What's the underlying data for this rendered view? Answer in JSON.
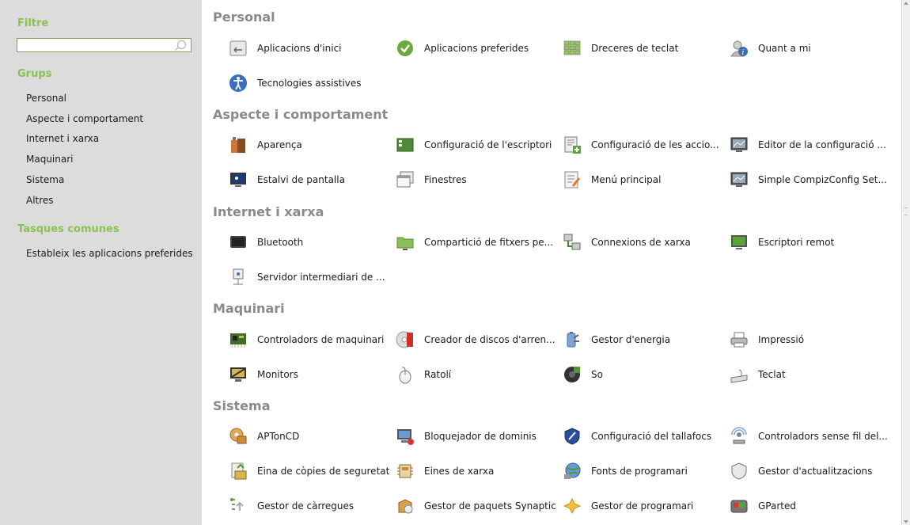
{
  "sidebar": {
    "filter_heading": "Filtre",
    "search_placeholder": "",
    "groups_heading": "Grups",
    "groups": [
      "Personal",
      "Aspecte i comportament",
      "Internet i xarxa",
      "Maquinari",
      "Sistema",
      "Altres"
    ],
    "tasks_heading": "Tasques comunes",
    "tasks": [
      "Estableix les aplicacions preferides"
    ]
  },
  "sections": [
    {
      "title": "Personal",
      "items": [
        {
          "label": "Aplicacions d'inici",
          "icon": "startup-apps-icon"
        },
        {
          "label": "Aplicacions preferides",
          "icon": "preferred-apps-icon"
        },
        {
          "label": "Dreceres de teclat",
          "icon": "keyboard-shortcuts-icon"
        },
        {
          "label": "Quant a mi",
          "icon": "about-me-icon"
        },
        {
          "label": "Tecnologies assistives",
          "icon": "accessibility-icon"
        }
      ]
    },
    {
      "title": "Aspecte i comportament",
      "items": [
        {
          "label": "Aparença",
          "icon": "appearance-icon"
        },
        {
          "label": "Configuració de l'escriptori",
          "icon": "desktop-settings-icon"
        },
        {
          "label": "Configuració de les accio...",
          "icon": "actions-settings-icon"
        },
        {
          "label": "Editor de la configuració ...",
          "icon": "config-editor-icon"
        },
        {
          "label": "Estalvi de pantalla",
          "icon": "screensaver-icon"
        },
        {
          "label": "Finestres",
          "icon": "windows-icon"
        },
        {
          "label": "Menú principal",
          "icon": "main-menu-icon"
        },
        {
          "label": "Simple CompizConfig Set...",
          "icon": "compizconfig-icon"
        }
      ]
    },
    {
      "title": "Internet i xarxa",
      "items": [
        {
          "label": "Bluetooth",
          "icon": "bluetooth-icon"
        },
        {
          "label": "Compartició de fitxers pe...",
          "icon": "file-sharing-icon"
        },
        {
          "label": "Connexions de xarxa",
          "icon": "network-connections-icon"
        },
        {
          "label": "Escriptori remot",
          "icon": "remote-desktop-icon"
        },
        {
          "label": "Servidor intermediari de ...",
          "icon": "proxy-icon"
        }
      ]
    },
    {
      "title": "Maquinari",
      "items": [
        {
          "label": "Controladors de maquinari",
          "icon": "hardware-drivers-icon"
        },
        {
          "label": "Creador de discos d'arren...",
          "icon": "startup-disk-icon"
        },
        {
          "label": "Gestor d'energia",
          "icon": "power-manager-icon"
        },
        {
          "label": "Impressió",
          "icon": "printer-icon"
        },
        {
          "label": "Monitors",
          "icon": "monitors-icon"
        },
        {
          "label": "Ratolí",
          "icon": "mouse-icon"
        },
        {
          "label": "So",
          "icon": "sound-icon"
        },
        {
          "label": "Teclat",
          "icon": "keyboard-icon"
        }
      ]
    },
    {
      "title": "Sistema",
      "items": [
        {
          "label": "APTonCD",
          "icon": "aptoncd-icon"
        },
        {
          "label": "Bloquejador de dominis",
          "icon": "domain-blocker-icon"
        },
        {
          "label": "Configuració del tallafocs",
          "icon": "firewall-icon"
        },
        {
          "label": "Controladors sense fil del...",
          "icon": "wireless-drivers-icon"
        },
        {
          "label": "Eina de còpies de seguretat",
          "icon": "backup-icon"
        },
        {
          "label": "Eines de xarxa",
          "icon": "network-tools-icon"
        },
        {
          "label": "Fonts de programari",
          "icon": "software-sources-icon"
        },
        {
          "label": "Gestor d'actualitzacions",
          "icon": "update-manager-icon"
        },
        {
          "label": "Gestor de càrregues",
          "icon": "upload-manager-icon"
        },
        {
          "label": "Gestor de paquets Synaptic",
          "icon": "synaptic-icon"
        },
        {
          "label": "Gestor de programari",
          "icon": "software-manager-icon"
        },
        {
          "label": "GParted",
          "icon": "gparted-icon"
        }
      ]
    }
  ],
  "colors": {
    "sidebar_bg": "#dcdcdc",
    "heading_green": "#8cc152",
    "category_gray": "#8a8a8a"
  }
}
